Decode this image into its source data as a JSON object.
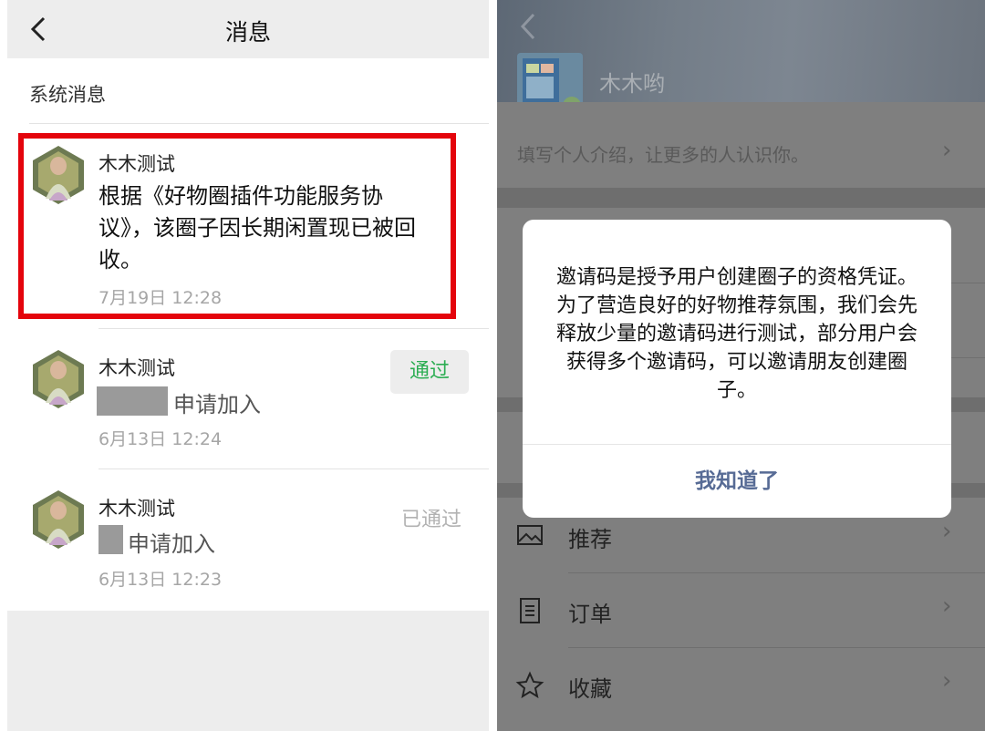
{
  "left": {
    "nav": {
      "title": "消息",
      "back_icon": "chevron-left-icon"
    },
    "section_title": "系统消息",
    "messages": [
      {
        "sender": "木木测试",
        "text": "根据《好物圈插件功能服务协议》，该圈子因长期闲置现已被回收。",
        "time": "7月19日 12:28",
        "highlight_color": "#e4040c"
      },
      {
        "sender": "木木测试",
        "text": "申请加入",
        "time": "6月13日 12:24",
        "action": "通过",
        "action_color": "#2bad52"
      },
      {
        "sender": "木木测试",
        "text": "申请加入",
        "time": "6月13日 12:23",
        "status": "已通过"
      }
    ]
  },
  "right": {
    "profile": {
      "name": "木木哟",
      "intro": "填写个人介绍，让更多的人认识你。"
    },
    "menu": [
      {
        "label": "推荐",
        "icon": "image-icon"
      },
      {
        "label": "订单",
        "icon": "order-list-icon"
      },
      {
        "label": "收藏",
        "icon": "star-icon"
      }
    ],
    "dialog": {
      "message": "邀请码是授予用户创建圈子的资格凭证。为了营造良好的好物推荐氛围，我们会先释放少量的邀请码进行测试，部分用户会获得多个邀请码，可以邀请朋友创建圈子。",
      "button": "我知道了",
      "button_color": "#576b95"
    }
  }
}
